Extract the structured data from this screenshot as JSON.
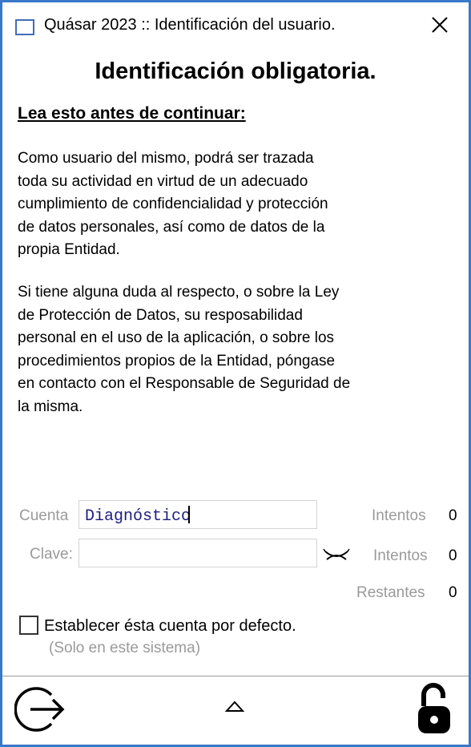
{
  "window": {
    "title": "Quásar 2023 :: Identificación del usuario."
  },
  "header": {
    "title": "Identificación obligatoria."
  },
  "notice": {
    "subtitle": "Lea esto antes de continuar:",
    "paragraph1": "  Como usuario del mismo, podrá ser trazada\ntoda su actividad en virtud de un adecuado\ncumplimiento de confidencialidad y protección\nde datos personales, así como de datos de la\npropia Entidad.",
    "paragraph2": "  Si tiene alguna duda al respecto, o sobre la Ley\nde Protección de Datos, su resposabilidad\npersonal en el uso de la aplicación, o sobre los\nprocedimientos propios de la Entidad, póngase\nen contacto con el Responsable de Seguridad de\nla misma."
  },
  "form": {
    "account_label": "Cuenta",
    "account_value": "Diagnóstico",
    "password_label": "Clave:",
    "password_value": "",
    "attempts_label": "Intentos",
    "attempts_account": "0",
    "attempts_password": "0",
    "remaining_label": "Restantes",
    "remaining_value": "0"
  },
  "default_account": {
    "label": "Establecer ésta cuenta por defecto.",
    "note": "(Solo en este sistema)",
    "checked": false
  },
  "icons": {
    "app": "window-icon",
    "close": "close-icon",
    "show_password": "eye-closed-icon",
    "exit": "exit-icon",
    "expand": "chevron-up-icon",
    "unlock": "unlock-icon"
  },
  "colors": {
    "window_border": "#3a78c9",
    "input_text": "#1f1d7e",
    "muted_label": "#9a9a9a"
  }
}
